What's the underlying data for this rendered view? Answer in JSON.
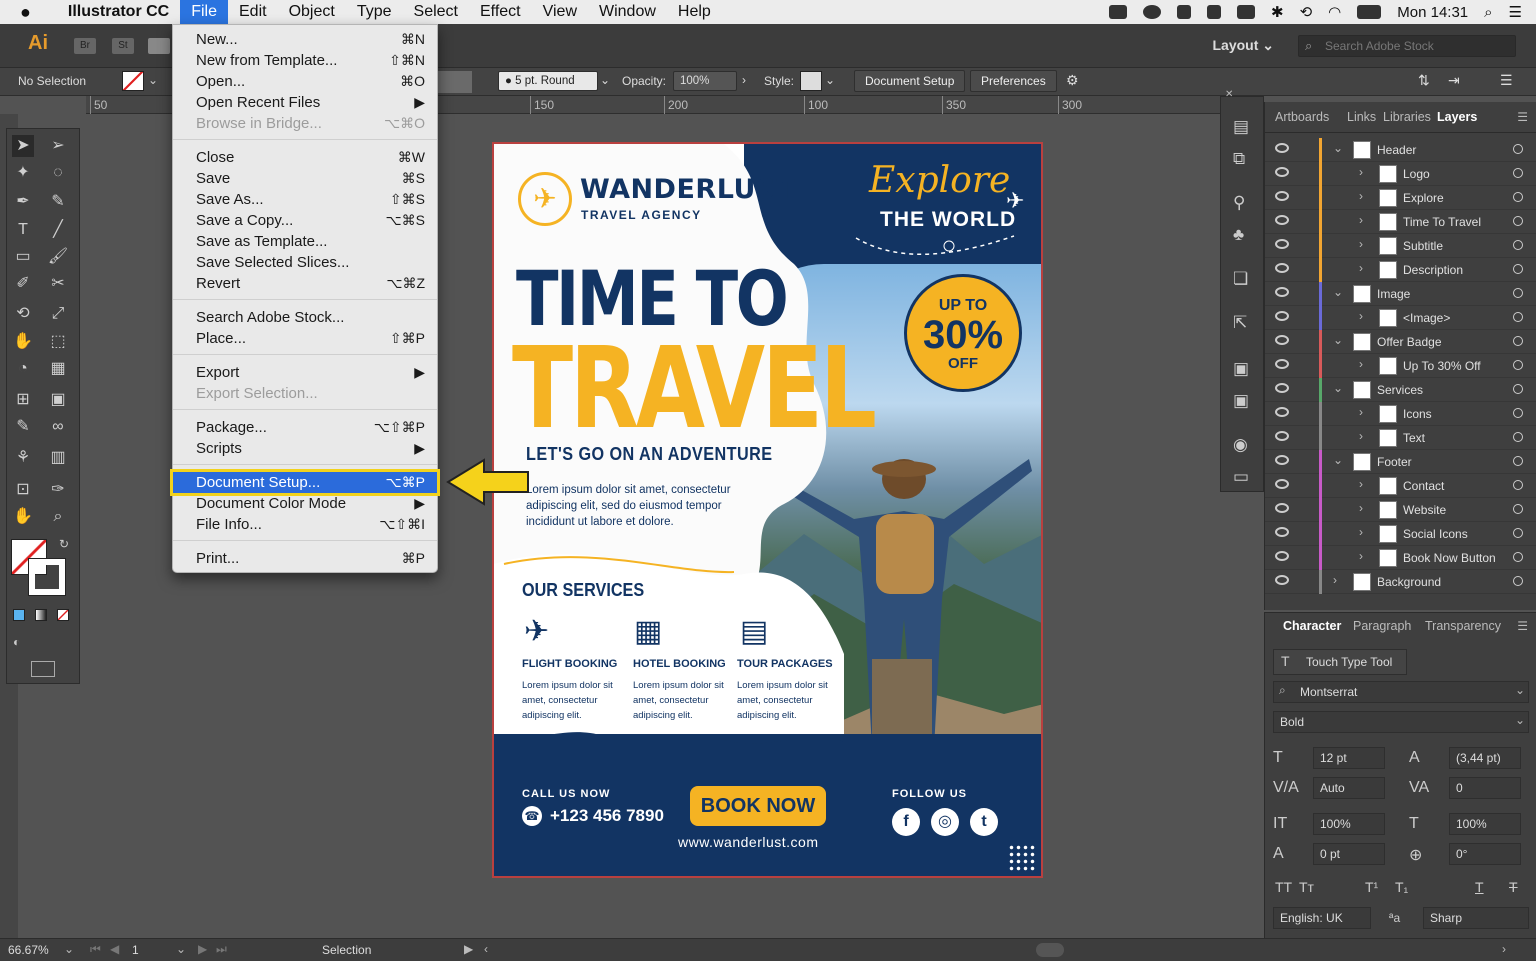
{
  "menubar": {
    "apple": "",
    "app": "Illustrator CC",
    "items": [
      "File",
      "Edit",
      "Object",
      "Type",
      "Select",
      "Effect",
      "View",
      "Window",
      "Help"
    ],
    "clock": "Mon 14:31"
  },
  "appbar": {
    "logo": "Ai",
    "br": "Br",
    "st": "St",
    "layout": "Layout",
    "search_placeholder": "Search Adobe Stock"
  },
  "control": {
    "selection": "No Selection",
    "stroke_profile": "5 pt. Round",
    "opacity_label": "Opacity:",
    "opacity": "100%",
    "style_label": "Style:",
    "doc_setup": "Document Setup",
    "preferences": "Preferences"
  },
  "ruler": [
    "50",
    "150",
    "200",
    "100",
    "350",
    "300"
  ],
  "file_menu": [
    {
      "label": "New...",
      "shortcut": "⌘N"
    },
    {
      "label": "New from Template...",
      "shortcut": "⇧⌘N"
    },
    {
      "label": "Open...",
      "shortcut": "⌘O"
    },
    {
      "label": "Open Recent Files",
      "shortcut": "▶"
    },
    {
      "label": "Browse in Bridge...",
      "shortcut": "⌥⌘O"
    },
    {
      "label": "Close",
      "shortcut": "⌘W"
    },
    {
      "label": "Save",
      "shortcut": "⌘S"
    },
    {
      "label": "Save As...",
      "shortcut": "⇧⌘S"
    },
    {
      "label": "Save a Copy...",
      "shortcut": "⌥⌘S"
    },
    {
      "label": "Save as Template...",
      "shortcut": ""
    },
    {
      "label": "Save Selected Slices...",
      "shortcut": ""
    },
    {
      "label": "Revert",
      "shortcut": "⌥⌘Z"
    },
    {
      "label": "Search Adobe Stock...",
      "shortcut": ""
    },
    {
      "label": "Place...",
      "shortcut": "⇧⌘P"
    },
    {
      "label": "Export",
      "shortcut": "▶"
    },
    {
      "label": "Export Selection...",
      "shortcut": ""
    },
    {
      "label": "Package...",
      "shortcut": "⌥⇧⌘P"
    },
    {
      "label": "Scripts",
      "shortcut": "▶"
    },
    {
      "label": "Document Setup...",
      "shortcut": "⌥⌘P"
    },
    {
      "label": "Document Color Mode",
      "shortcut": "▶"
    },
    {
      "label": "File Info...",
      "shortcut": "⌥⇧⌘I"
    },
    {
      "label": "Print...",
      "shortcut": "⌘P"
    }
  ],
  "flyer": {
    "brand": "WANDERLUST",
    "brand_sub": "TRAVEL AGENCY",
    "explore": "Explore",
    "the_world": "THE WORLD",
    "badge_top": "UP TO",
    "badge_pct": "30%",
    "badge_off": "OFF",
    "headline1": "TIME TO",
    "headline2": "TRAVEL",
    "tagline": "LET'S GO ON AN ADVENTURE",
    "intro": "Lorem ipsum dolor sit amet, consectetur adipiscing elit, sed do eiusmod tempor incididunt ut labore et dolore.",
    "services_title": "OUR SERVICES",
    "services": [
      {
        "title": "FLIGHT BOOKING",
        "body": "Lorem ipsum dolor sit amet, consectetur adipiscing elit."
      },
      {
        "title": "HOTEL BOOKING",
        "body": "Lorem ipsum dolor sit amet, consectetur adipiscing elit."
      },
      {
        "title": "TOUR PACKAGES",
        "body": "Lorem ipsum dolor sit amet, consectetur adipiscing elit."
      }
    ],
    "call_label": "CALL US NOW",
    "phone": "+123 456 7890",
    "book_now": "BOOK NOW",
    "website": "www.wanderlust.com",
    "follow": "FOLLOW US",
    "social": [
      "f",
      "◎",
      "t"
    ]
  },
  "layers": {
    "tabs": [
      "Artboards",
      "Links",
      "Libraries",
      "Layers"
    ],
    "rows": [
      {
        "name": "Header",
        "level": 0,
        "open": true,
        "color": "#f2a531"
      },
      {
        "name": "Logo",
        "level": 1,
        "color": "#f2a531"
      },
      {
        "name": "Explore",
        "level": 1,
        "color": "#f2a531"
      },
      {
        "name": "Time To Travel",
        "level": 1,
        "color": "#f2a531"
      },
      {
        "name": "Subtitle",
        "level": 1,
        "color": "#f2a531"
      },
      {
        "name": "Description",
        "level": 1,
        "color": "#f2a531"
      },
      {
        "name": "Image",
        "level": 0,
        "open": true,
        "color": "#6a6ad8"
      },
      {
        "name": "<Image>",
        "level": 1,
        "color": "#6a6ad8"
      },
      {
        "name": "Offer Badge",
        "level": 0,
        "open": true,
        "color": "#d85a5a"
      },
      {
        "name": "Up To 30% Off",
        "level": 1,
        "color": "#d85a5a"
      },
      {
        "name": "Services",
        "level": 0,
        "open": true,
        "color": "#58a86a"
      },
      {
        "name": "Icons",
        "level": 1,
        "color": "#888"
      },
      {
        "name": "Text",
        "level": 1,
        "color": "#888"
      },
      {
        "name": "Footer",
        "level": 0,
        "open": true,
        "color": "#c85ac8"
      },
      {
        "name": "Contact",
        "level": 1,
        "color": "#c85ac8"
      },
      {
        "name": "Website",
        "level": 1,
        "color": "#c85ac8"
      },
      {
        "name": "Social Icons",
        "level": 1,
        "color": "#c85ac8"
      },
      {
        "name": "Book Now Button",
        "level": 1,
        "color": "#c85ac8"
      },
      {
        "name": "Background",
        "level": 0,
        "open": false,
        "color": "#888"
      }
    ]
  },
  "character": {
    "tabs": [
      "Character",
      "Paragraph",
      "Transparency"
    ],
    "touch_tool": "Touch Type Tool",
    "font": "Montserrat",
    "style": "Bold",
    "size": "12 pt",
    "leading": "(3,44 pt)",
    "kerning": "Auto",
    "tracking": "0",
    "vscale": "100%",
    "hscale": "100%",
    "baseline": "0 pt",
    "rotation": "0°",
    "language": "English: UK",
    "antialias": "Sharp"
  },
  "status": {
    "zoom": "66.67%",
    "artboard": "1",
    "tool": "Selection"
  }
}
